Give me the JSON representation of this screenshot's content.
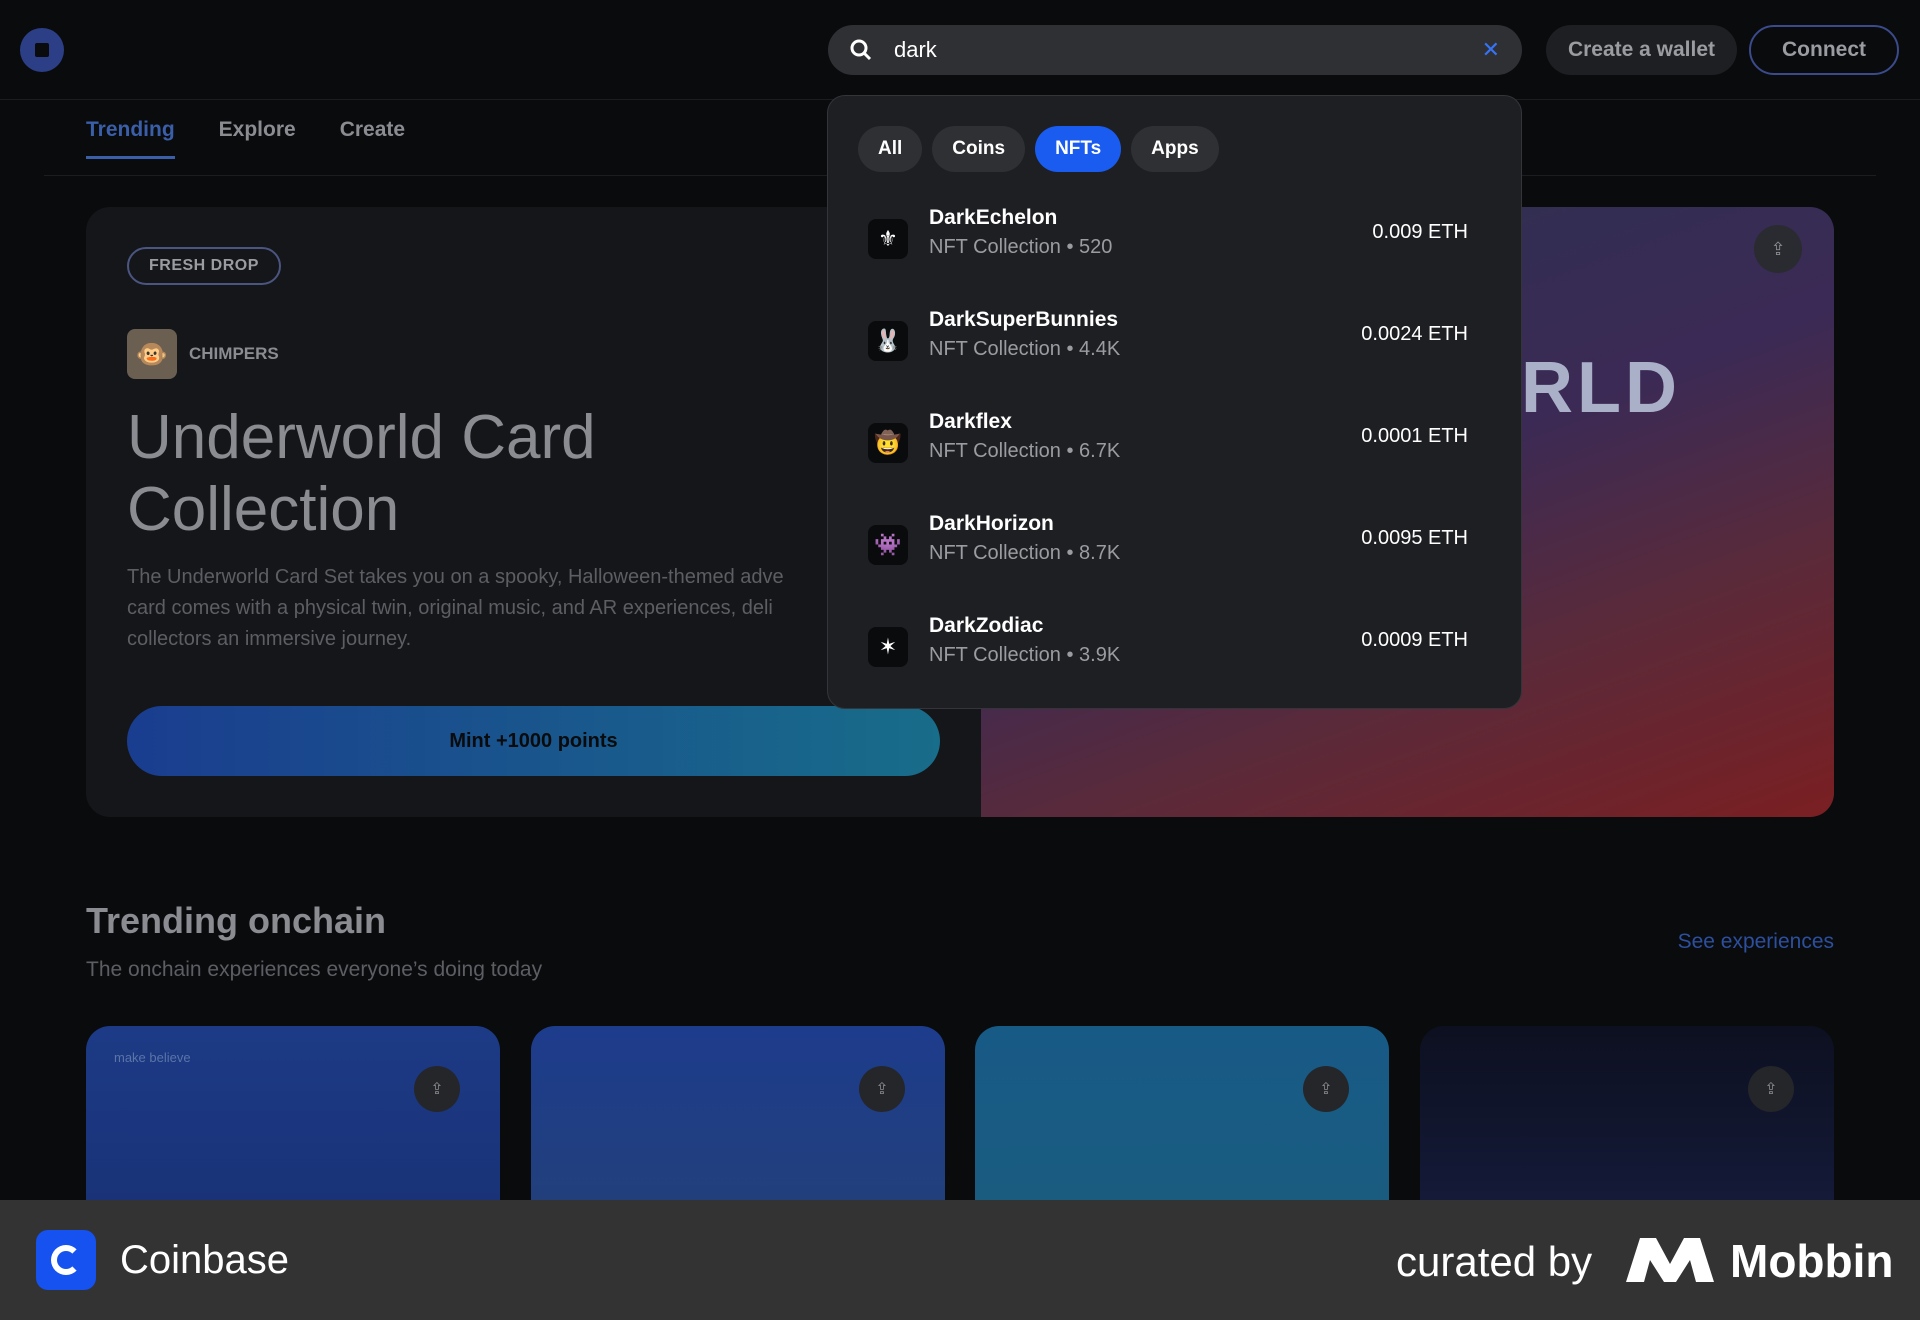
{
  "header": {
    "search_value": "dark",
    "create_wallet": "Create a wallet",
    "connect": "Connect"
  },
  "tabs": [
    "Trending",
    "Explore",
    "Create"
  ],
  "hero": {
    "badge": "FRESH DROP",
    "creator": "CHIMPERS",
    "title": "Underworld Card Collection",
    "description": "The Underworld Card Set takes you on a spooky, Halloween-themed adve card comes with a physical twin, original music, and AR experiences, deli collectors an immersive journey.",
    "mint_label": "Mint +1000 points",
    "art_text": "RLD"
  },
  "dropdown": {
    "filters": [
      "All",
      "Coins",
      "NFTs",
      "Apps"
    ],
    "results": [
      {
        "name": "DarkEchelon",
        "sub": "NFT Collection • 520",
        "price": "0.009 ETH",
        "icon": "⚜"
      },
      {
        "name": "DarkSuperBunnies",
        "sub": "NFT Collection • 4.4K",
        "price": "0.0024 ETH",
        "icon": "🐰"
      },
      {
        "name": "Darkflex",
        "sub": "NFT Collection • 6.7K",
        "price": "0.0001 ETH",
        "icon": "🤠"
      },
      {
        "name": "DarkHorizon",
        "sub": "NFT Collection • 8.7K",
        "price": "0.0095 ETH",
        "icon": "👾"
      },
      {
        "name": "DarkZodiac",
        "sub": "NFT Collection • 3.9K",
        "price": "0.0009 ETH",
        "icon": "✶"
      }
    ]
  },
  "trending": {
    "title": "Trending onchain",
    "subtitle": "The onchain experiences everyone’s doing today",
    "see_all": "See experiences",
    "card1_label": "make believe"
  },
  "footer": {
    "app_name": "Coinbase",
    "curated": "curated by",
    "brand": "Mobbin"
  },
  "colors": {
    "accent": "#1a5cf0",
    "link": "#3773f5"
  }
}
